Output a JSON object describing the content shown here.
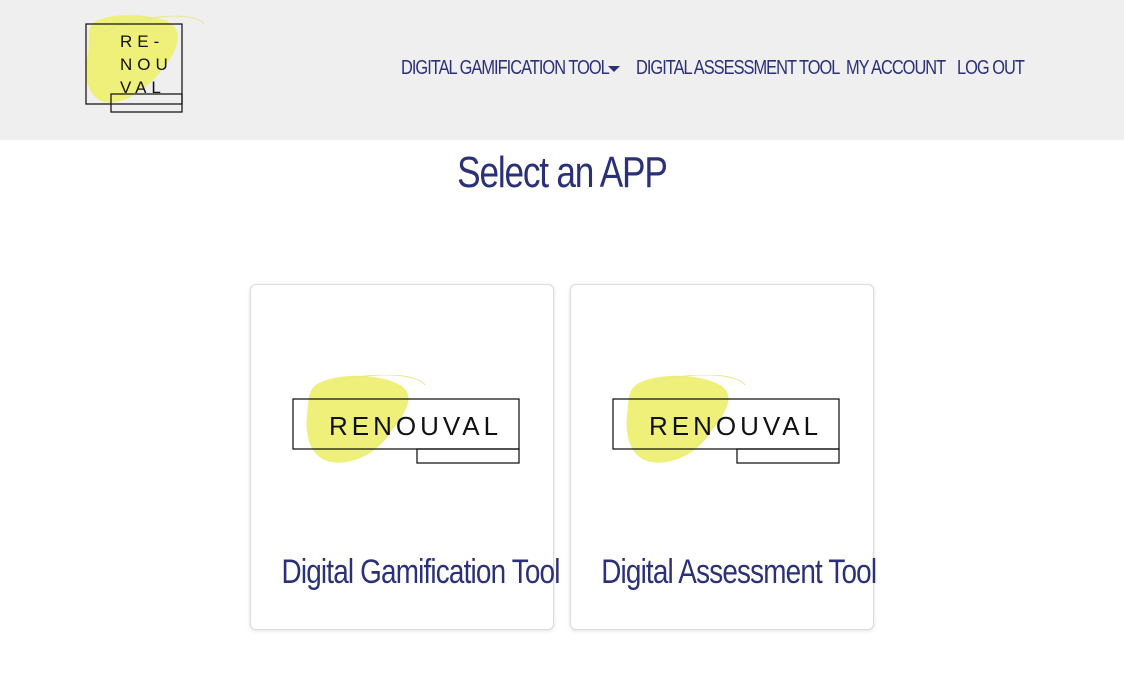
{
  "header": {
    "logo_text": {
      "line1": "RE-",
      "line2": "NOU",
      "line3": "VAL"
    },
    "nav": [
      {
        "label": "DIGITAL GAMIFICATION TOOL",
        "has_dropdown": true
      },
      {
        "label": "DIGITAL ASSESSMENT TOOL"
      },
      {
        "label": "MY ACCOUNT"
      },
      {
        "label": "LOG OUT"
      }
    ]
  },
  "main": {
    "title": "Select an APP",
    "apps": [
      {
        "brand_text": "RENOUVAL",
        "title": "Digital Gamification Tool"
      },
      {
        "brand_text": "RENOUVAL",
        "title": "Digital Assessment Tool"
      }
    ]
  },
  "colors": {
    "text": "#2b3179",
    "header_bg": "#efefef",
    "logo_blob": "#eef07a"
  }
}
